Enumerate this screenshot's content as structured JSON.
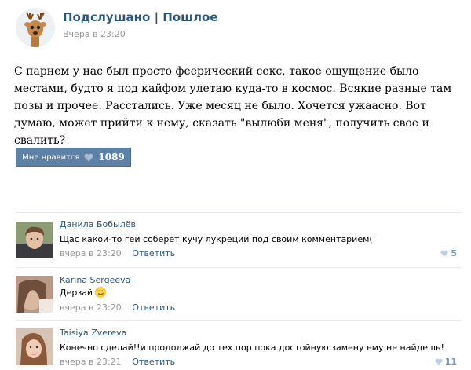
{
  "group": {
    "name": "Подслушано | Пошлое",
    "time": "Вчера в 23:20"
  },
  "post": {
    "text": "С парнем у нас был просто феерический секс, такое ощущение было местами, будто я под кайфом улетаю куда-то в космос. Всякие разные там позы и прочее. Расстались. Уже месяц не было. Хочется ужаасно. Вот думаю, может прийти к нему, сказать \"вылюби меня\", получить свое и свалить?"
  },
  "like_button": {
    "label": "Мне нравится",
    "count": "1089"
  },
  "comments": [
    {
      "author": "Данила Бобылёв",
      "text": "Щас какой-то гей соберёт кучу лукреций под своим комментарием(",
      "time": "вчера в 23:20",
      "reply_label": "Ответить",
      "likes": "5"
    },
    {
      "author": "Karina Sergeeva",
      "text": "Дерзай",
      "time": "вчера в 23:20",
      "reply_label": "Ответить",
      "likes": ""
    },
    {
      "author": "Taisiya Zvereva",
      "text": "Конечно сделай!!и продолжай до тех пор пока достойную замену ему не найдешь!",
      "time": "вчера в 23:21",
      "reply_label": "Ответить",
      "likes": "11"
    }
  ],
  "colors": {
    "link": "#2b587a",
    "button_bg": "#5e81a8",
    "muted": "#999999"
  },
  "icons": [
    "deer-avatar",
    "heart-icon",
    "smiley-icon"
  ]
}
